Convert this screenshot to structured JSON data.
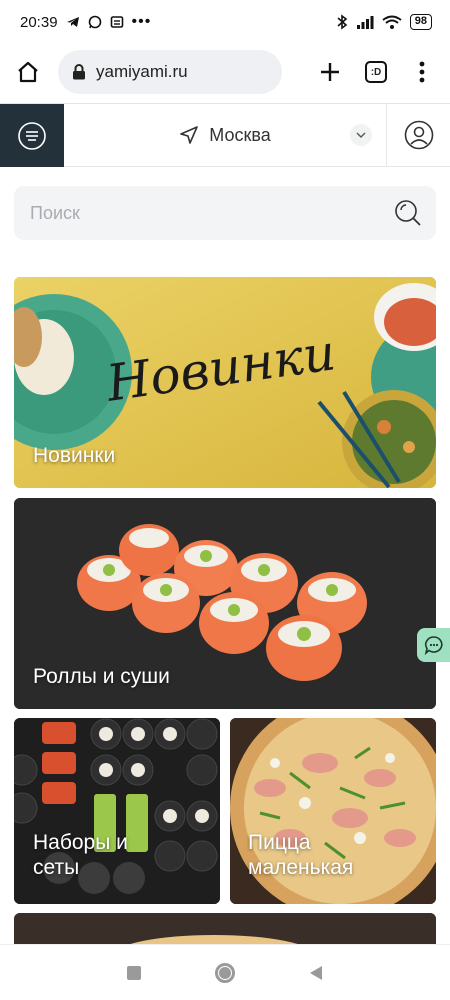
{
  "status_bar": {
    "time": "20:39",
    "battery": "98"
  },
  "browser": {
    "url": "yamiyami.ru",
    "tabs_label": ":D"
  },
  "header": {
    "city": "Москва"
  },
  "search": {
    "placeholder": "Поиск"
  },
  "categories": [
    {
      "label": "Новинки",
      "banner_script": "Новинки"
    },
    {
      "label": "Роллы и суши"
    },
    {
      "label": "Наборы и\nсеты"
    },
    {
      "label": "Пицца\nмаленькая"
    }
  ],
  "colors": {
    "menu_tile": "#22313a",
    "chat_fab": "#9fe0c1",
    "banner_yellow": "#e2c54d"
  }
}
